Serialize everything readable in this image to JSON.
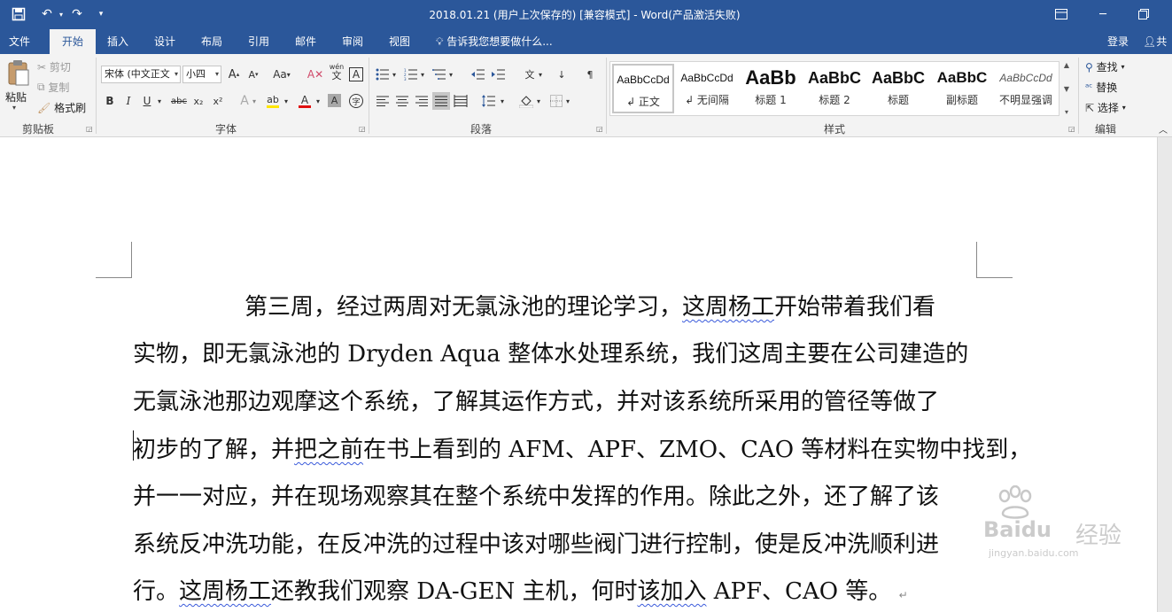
{
  "titlebar": {
    "title": "2018.01.21 (用户上次保存的) [兼容模式] - Word(产品激活失败)",
    "qa_save_icon": "save-icon",
    "qa_undo_icon": "undo-icon",
    "qa_redo_icon": "redo-icon",
    "qa_customize_icon": "customize-icon"
  },
  "tabs": [
    {
      "label": "文件",
      "active": false
    },
    {
      "label": "开始",
      "active": true
    },
    {
      "label": "插入",
      "active": false
    },
    {
      "label": "设计",
      "active": false
    },
    {
      "label": "布局",
      "active": false
    },
    {
      "label": "引用",
      "active": false
    },
    {
      "label": "邮件",
      "active": false
    },
    {
      "label": "审阅",
      "active": false
    },
    {
      "label": "视图",
      "active": false
    }
  ],
  "tellme": "告诉我您想要做什么...",
  "signin": "登录",
  "share": "共",
  "clipboard": {
    "paste": "粘贴",
    "cut": "剪切",
    "copy": "复制",
    "format_painter": "格式刷",
    "group": "剪贴板"
  },
  "font": {
    "font_name": "宋体 (中文正文",
    "font_size": "小四",
    "bold": "B",
    "italic": "I",
    "underline": "U",
    "strike": "abc",
    "subscript": "x₂",
    "superscript": "x²",
    "change_case": "Aa",
    "phonetic_top": "wén",
    "phonetic_bottom": "文",
    "border_char": "A",
    "group": "字体"
  },
  "paragraph": {
    "group": "段落"
  },
  "styles": {
    "items": [
      {
        "preview": "AaBbCcDd",
        "label": "↲ 正文"
      },
      {
        "preview": "AaBbCcDd",
        "label": "↲ 无间隔"
      },
      {
        "preview": "AaBb",
        "label": "标题 1"
      },
      {
        "preview": "AaBbC",
        "label": "标题 2"
      },
      {
        "preview": "AaBbC",
        "label": "标题"
      },
      {
        "preview": "AaBbC",
        "label": "副标题"
      },
      {
        "preview": "AaBbCcDd",
        "label": "不明显强调"
      }
    ],
    "group": "样式"
  },
  "editing": {
    "find": "查找",
    "replace": "替换",
    "select": "选择",
    "group": "编辑"
  },
  "document": {
    "lines": [
      {
        "pre": "第三周，经过两周对无氯泳池的理论学习，",
        "mark": "这周杨工",
        "post": "开始带着我们看"
      },
      {
        "pre": "实物，即无氯泳池的 Dryden Aqua 整体水处理系统，我们这周主要在公司建造的",
        "mark": "",
        "post": ""
      },
      {
        "pre": "无氯泳池那边观摩这个系统，了解其运作方式，并对该系统所采用的管径等做了",
        "mark": "",
        "post": ""
      },
      {
        "pre": "初步的了解，并",
        "mark": "把之前",
        "post": "在书上看到的 AFM、APF、ZMO、CAO 等材料在实物中找到，"
      },
      {
        "pre": "并一一对应，并在现场观察其在整个系统中发挥的作用。除此之外，还了解了该",
        "mark": "",
        "post": ""
      },
      {
        "pre": "系统反冲洗功能，在反冲洗的过程中该对哪些阀门进行控制，使是反冲洗",
        "mark": "顺利进",
        "post": ""
      },
      {
        "pre": "行。",
        "mark": "这周杨工",
        "post": "还教我们观察 DA-GEN  主机，何时",
        "mark2": "该加入",
        "post2": " APF、CAO 等。"
      }
    ],
    "pilcrow": "↵"
  },
  "watermark": {
    "brand": "Bai",
    "du": "du",
    "jy": "经验",
    "url": "jingyan.baidu.com"
  }
}
